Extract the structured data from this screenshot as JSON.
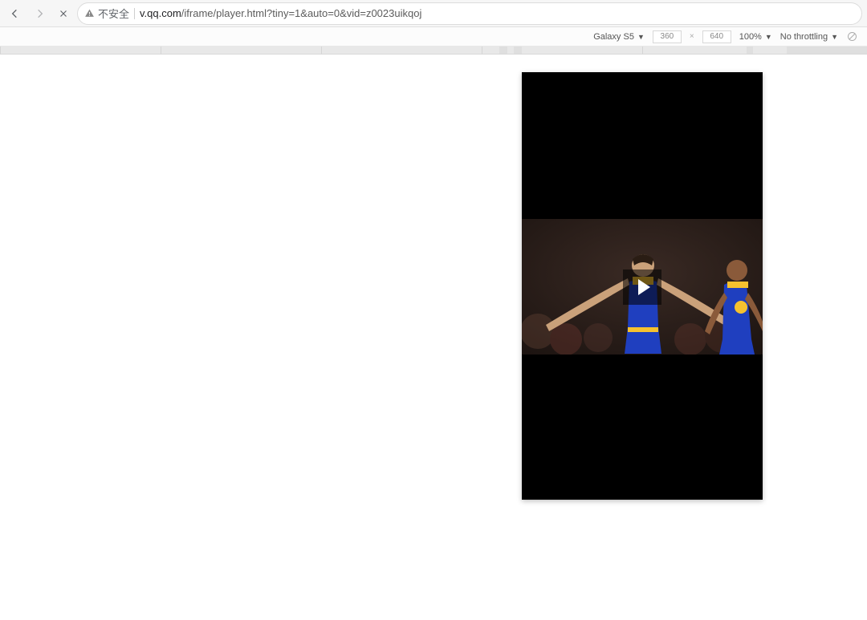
{
  "browser": {
    "security_label": "不安全",
    "url_host": "v.qq.com",
    "url_path": "/iframe/player.html?tiny=1&auto=0&vid=z0023uikqoj"
  },
  "device_toolbar": {
    "device": "Galaxy S5",
    "width": "360",
    "height": "640",
    "zoom": "100%",
    "throttling": "No throttling"
  }
}
